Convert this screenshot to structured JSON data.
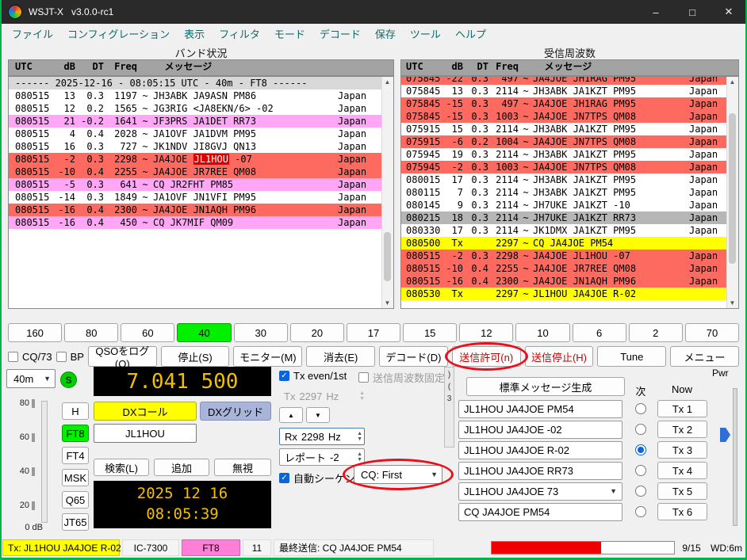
{
  "window": {
    "title": "WSJT-X   v3.0.0-rc1",
    "controls": {
      "minimize": "–",
      "maximize": "□",
      "close": "✕"
    }
  },
  "menu": {
    "items": [
      "ファイル",
      "コンフィグレーション",
      "表示",
      "フィルタ",
      "モード",
      "デコード",
      "保存",
      "ツール",
      "ヘルプ"
    ]
  },
  "band_activity": {
    "title": "バンド状況",
    "headers": [
      "UTC",
      "dB",
      "DT",
      "Freq",
      "メッセージ"
    ],
    "banner": "------ 2025-12-16 - 08:05:15 UTC - 40m - FT8 ------",
    "rows": [
      {
        "utc": "080515",
        "db": "13",
        "dt": "0.3",
        "freq": "1197",
        "msg": "JH3ABK JA9ASN PM86",
        "loc": "Japan",
        "bg": "none"
      },
      {
        "utc": "080515",
        "db": "12",
        "dt": "0.2",
        "freq": "1565",
        "msg": "JG3RIG <JA8EKN/6> -02",
        "loc": "Japan",
        "bg": "none"
      },
      {
        "utc": "080515",
        "db": "21",
        "dt": "-0.2",
        "freq": "1641",
        "msg": "JF3PRS JA1DET RR73",
        "loc": "Japan",
        "bg": "pink"
      },
      {
        "utc": "080515",
        "db": "4",
        "dt": "0.4",
        "freq": "2028",
        "msg": "JA1OVF JA1DVM PM95",
        "loc": "Japan",
        "bg": "none"
      },
      {
        "utc": "080515",
        "db": "16",
        "dt": "0.3",
        "freq": "727",
        "msg": "JK1NDV JI8GVJ QN13",
        "loc": "Japan",
        "bg": "none"
      },
      {
        "utc": "080515",
        "db": "-2",
        "dt": "0.3",
        "freq": "2298",
        "msg": "JA4JOE JL1HOU -07",
        "hl": "JL1HOU",
        "loc": "Japan",
        "bg": "red"
      },
      {
        "utc": "080515",
        "db": "-10",
        "dt": "0.4",
        "freq": "2255",
        "msg": "JA4JOE JR7REE QM08",
        "loc": "Japan",
        "bg": "red"
      },
      {
        "utc": "080515",
        "db": "-5",
        "dt": "0.3",
        "freq": "641",
        "msg": "CQ JR2FHT PM85",
        "loc": "Japan",
        "bg": "pink"
      },
      {
        "utc": "080515",
        "db": "-14",
        "dt": "0.3",
        "freq": "1849",
        "msg": "JA1OVF JN1VFI PM95",
        "loc": "Japan",
        "bg": "none"
      },
      {
        "utc": "080515",
        "db": "-16",
        "dt": "0.4",
        "freq": "2300",
        "msg": "JA4JOE JN1AQH PM96",
        "loc": "Japan",
        "bg": "red"
      },
      {
        "utc": "080515",
        "db": "-16",
        "dt": "0.4",
        "freq": "450",
        "msg": "CQ JK7MIF QM09",
        "loc": "Japan",
        "bg": "pink"
      }
    ]
  },
  "rx_frequency": {
    "title": "受信周波数",
    "headers": [
      "UTC",
      "dB",
      "DT",
      "Freq",
      "メッセージ"
    ],
    "rows": [
      {
        "utc": "075845",
        "db": "-22",
        "dt": "0.3",
        "freq": "497",
        "msg": "JA4JOE JH1RAG PM95",
        "loc": "Japan",
        "bg": "red"
      },
      {
        "utc": "075845",
        "db": "13",
        "dt": "0.3",
        "freq": "2114",
        "msg": "JH3ABK JA1KZT PM95",
        "loc": "Japan",
        "bg": "none"
      },
      {
        "utc": "075845",
        "db": "-15",
        "dt": "0.3",
        "freq": "497",
        "msg": "JA4JOE JH1RAG PM95",
        "loc": "Japan",
        "bg": "red"
      },
      {
        "utc": "075845",
        "db": "-15",
        "dt": "0.3",
        "freq": "1003",
        "msg": "JA4JOE JN7TPS QM08",
        "loc": "Japan",
        "bg": "red"
      },
      {
        "utc": "075915",
        "db": "15",
        "dt": "0.3",
        "freq": "2114",
        "msg": "JH3ABK JA1KZT PM95",
        "loc": "Japan",
        "bg": "none"
      },
      {
        "utc": "075915",
        "db": "-6",
        "dt": "0.2",
        "freq": "1004",
        "msg": "JA4JOE JN7TPS QM08",
        "loc": "Japan",
        "bg": "red"
      },
      {
        "utc": "075945",
        "db": "19",
        "dt": "0.3",
        "freq": "2114",
        "msg": "JH3ABK JA1KZT PM95",
        "loc": "Japan",
        "bg": "none"
      },
      {
        "utc": "075945",
        "db": "-2",
        "dt": "0.3",
        "freq": "1003",
        "msg": "JA4JOE JN7TPS QM08",
        "loc": "Japan",
        "bg": "red"
      },
      {
        "utc": "080015",
        "db": "17",
        "dt": "0.3",
        "freq": "2114",
        "msg": "JH3ABK JA1KZT PM95",
        "loc": "Japan",
        "bg": "none"
      },
      {
        "utc": "080115",
        "db": "7",
        "dt": "0.3",
        "freq": "2114",
        "msg": "JH3ABK JA1KZT PM95",
        "loc": "Japan",
        "bg": "none"
      },
      {
        "utc": "080145",
        "db": "9",
        "dt": "0.3",
        "freq": "2114",
        "msg": "JH7UKE JA1KZT -10",
        "loc": "Japan",
        "bg": "none"
      },
      {
        "utc": "080215",
        "db": "18",
        "dt": "0.3",
        "freq": "2114",
        "msg": "JH7UKE JA1KZT RR73",
        "loc": "Japan",
        "bg": "gray"
      },
      {
        "utc": "080330",
        "db": "17",
        "dt": "0.3",
        "freq": "2114",
        "msg": "JK1DMX JA1KZT PM95",
        "loc": "Japan",
        "bg": "none"
      },
      {
        "utc": "080500",
        "db": "Tx",
        "dt": "",
        "freq": "2297",
        "msg": "CQ JA4JOE PM54",
        "loc": "",
        "bg": "yellow"
      },
      {
        "utc": "080515",
        "db": "-2",
        "dt": "0.3",
        "freq": "2298",
        "msg": "JA4JOE JL1HOU -07",
        "loc": "Japan",
        "bg": "red"
      },
      {
        "utc": "080515",
        "db": "-10",
        "dt": "0.4",
        "freq": "2255",
        "msg": "JA4JOE JR7REE QM08",
        "loc": "Japan",
        "bg": "red"
      },
      {
        "utc": "080515",
        "db": "-16",
        "dt": "0.4",
        "freq": "2300",
        "msg": "JA4JOE JN1AQH PM96",
        "loc": "Japan",
        "bg": "red"
      },
      {
        "utc": "080530",
        "db": "Tx",
        "dt": "",
        "freq": "2297",
        "msg": "JL1HOU JA4JOE R-02",
        "loc": "",
        "bg": "yellow"
      }
    ]
  },
  "bands": {
    "items": [
      "160",
      "80",
      "60",
      "40",
      "30",
      "20",
      "17",
      "15",
      "12",
      "10",
      "6",
      "2",
      "70"
    ],
    "active": "40"
  },
  "controls_row": {
    "cq73_label": "CQ/73",
    "bp_label": "BP",
    "buttons": [
      {
        "label": "QSOをログ(Q)",
        "name": "log-qso-button"
      },
      {
        "label": "停止(S)",
        "name": "stop-button"
      },
      {
        "label": "モニター(M)",
        "name": "monitor-button"
      },
      {
        "label": "消去(E)",
        "name": "erase-button"
      },
      {
        "label": "デコード(D)",
        "name": "decode-button"
      },
      {
        "label": "送信許可(n)",
        "name": "enable-tx-button",
        "red": true,
        "annotated": true
      },
      {
        "label": "送信停止(H)",
        "name": "halt-tx-button",
        "red": true
      },
      {
        "label": "Tune",
        "name": "tune-button"
      },
      {
        "label": "メニュー",
        "name": "menus-button"
      }
    ]
  },
  "left_panel": {
    "band_select": "40m",
    "s_button": "S",
    "frequency": "7.041 500",
    "meter_labels": [
      "80",
      "60",
      "40",
      "20"
    ],
    "meter_zero": "0 dB",
    "mode_buttons": [
      "H",
      "FT8",
      "FT4",
      "MSK",
      "Q65",
      "JT65"
    ],
    "active_mode": "FT8",
    "dx_call_label": "DXコール",
    "dx_grid_label": "DXグリッド",
    "dx_call_value": "JL1HOU",
    "search_label": "検索(L)",
    "add_label": "追加",
    "ignore_label": "無視",
    "date": "2025 12 16",
    "time": "08:05:39"
  },
  "center_panel": {
    "tx_even_label": "Tx even/1st",
    "hold_freq_label": "送信周波数固定",
    "tx_freq": {
      "prefix": "Tx",
      "value": "2297",
      "suffix": "Hz"
    },
    "rx_freq": {
      "prefix": "Rx",
      "value": "2298",
      "suffix": "Hz"
    },
    "report": {
      "label": "レポート",
      "value": "-2"
    },
    "autoseq_label": "自動シーケンス",
    "cq_combo": "CQ: First",
    "up_arrow": "▲",
    "down_arrow": "▼",
    "tab_chars": [
      ")",
      "(",
      "3"
    ]
  },
  "messages": {
    "generate_label": "標準メッセージ生成",
    "next_header": "次",
    "now_header": "Now",
    "pwr_label": "Pwr",
    "rows": [
      {
        "text": "JL1HOU JA4JOE PM54",
        "tx": "Tx 1",
        "selected": false,
        "combo": false
      },
      {
        "text": "JL1HOU JA4JOE -02",
        "tx": "Tx 2",
        "selected": false,
        "combo": false
      },
      {
        "text": "JL1HOU JA4JOE R-02",
        "tx": "Tx 3",
        "selected": true,
        "combo": false
      },
      {
        "text": "JL1HOU JA4JOE RR73",
        "tx": "Tx 4",
        "selected": false,
        "combo": false
      },
      {
        "text": "JL1HOU JA4JOE 73",
        "tx": "Tx 5",
        "selected": false,
        "combo": true
      },
      {
        "text": "CQ JA4JOE PM54",
        "tx": "Tx 6",
        "selected": false,
        "combo": false
      }
    ]
  },
  "status_bar": {
    "tx_status": "Tx: JL1HOU JA4JOE R-02",
    "rig": "IC-7300",
    "mode": "FT8",
    "depth": "11",
    "last_tx": "最終送信: CQ JA4JOE PM54",
    "progress": "9/15",
    "progress_pct": 60,
    "watchdog": "WD:6m"
  },
  "colors": {
    "accent_green": "#00f000",
    "row_red": "#ff6a60",
    "row_pink": "#ffa6f6",
    "tx_yellow": "#ffff00",
    "mode_pink": "#ff7fd8",
    "annotation_red": "#e8101c"
  }
}
